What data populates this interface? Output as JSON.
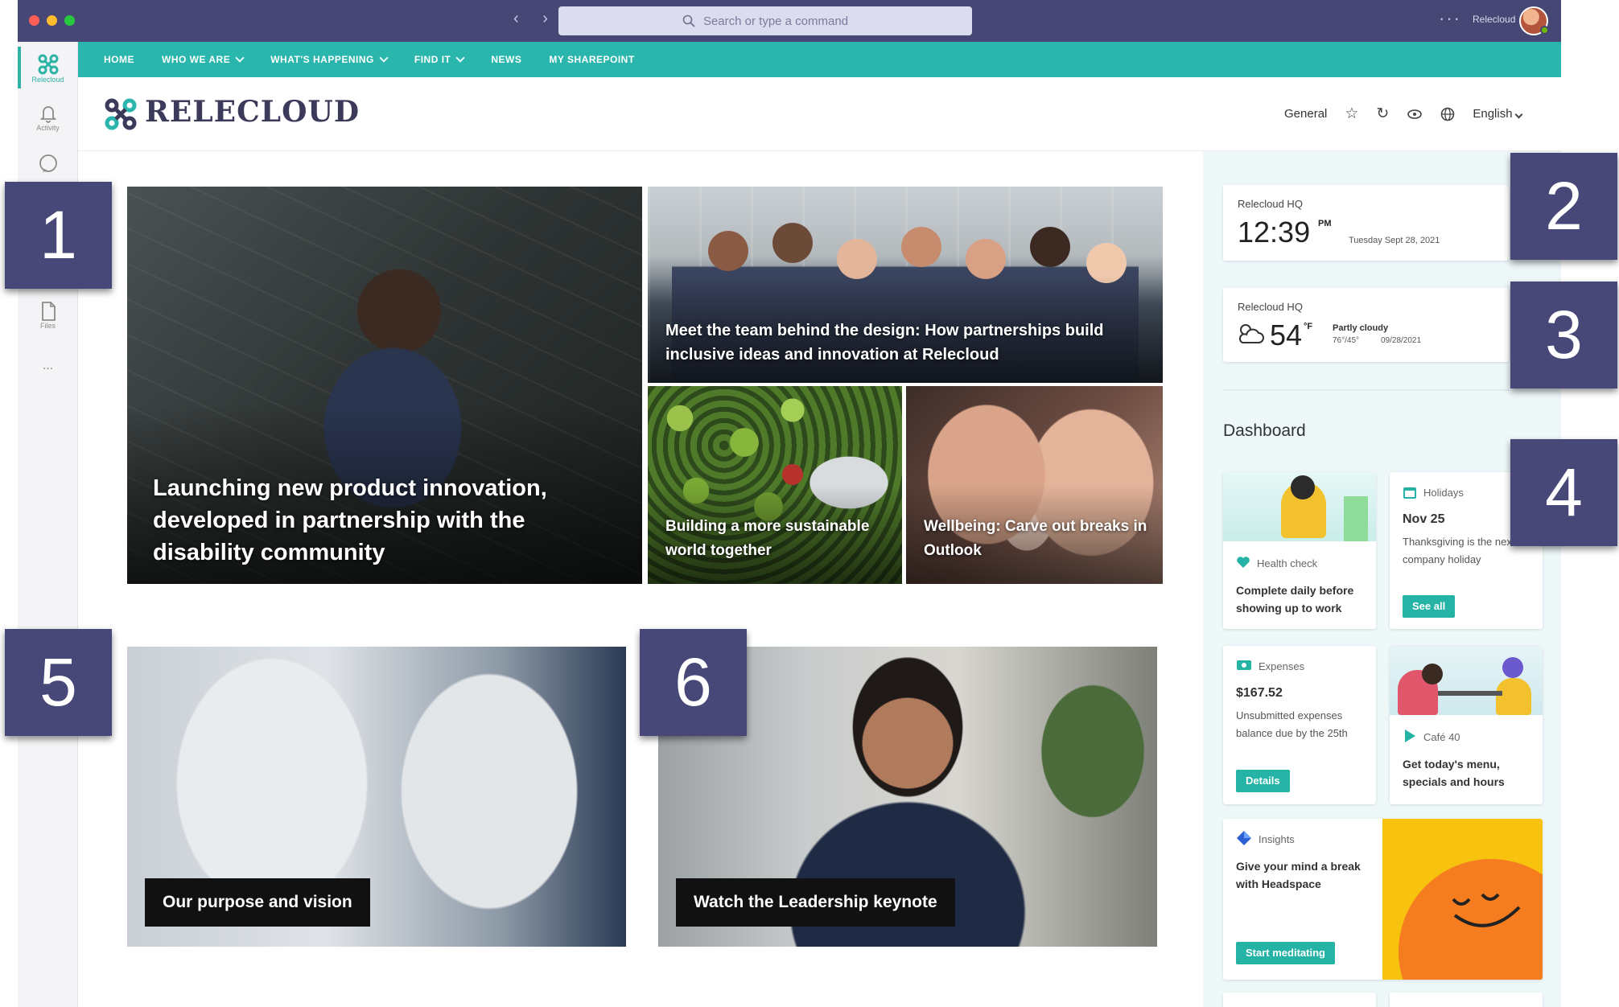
{
  "titlebar": {
    "search_placeholder": "Search or type a command",
    "nav_arrows": "‹ ›",
    "more": "···",
    "user_name": "Relecloud"
  },
  "rail": {
    "items": [
      {
        "label": "Relecloud",
        "icon": "relecloud-app-icon"
      },
      {
        "label": "Activity",
        "icon": "bell-icon"
      },
      {
        "label": "",
        "icon": "chat-icon"
      },
      {
        "label": "Files",
        "icon": "file-icon"
      }
    ],
    "more": "..."
  },
  "sitenav": {
    "items": [
      {
        "label": "HOME",
        "dropdown": false
      },
      {
        "label": "WHO WE ARE",
        "dropdown": true
      },
      {
        "label": "WHAT'S HAPPENING",
        "dropdown": true
      },
      {
        "label": "FIND IT",
        "dropdown": true
      },
      {
        "label": "NEWS",
        "dropdown": false
      },
      {
        "label": "MY SHAREPOINT",
        "dropdown": false
      }
    ]
  },
  "header": {
    "site_name": "RELECLOUD",
    "general_label": "General",
    "language": "English"
  },
  "news": {
    "hero": "Launching new product innovation, developed in partnership with the disability community",
    "top_right": "Meet the team behind the design: How partnerships build inclusive ideas and innovation at Relecloud",
    "bottom_mid": "Building a more sustainable world together",
    "bottom_right": "Wellbeing: Carve out breaks in Outlook"
  },
  "features": {
    "left": "Our purpose and vision",
    "right": "Watch the Leadership keynote"
  },
  "clock": {
    "location": "Relecloud HQ",
    "time": "12:39",
    "ampm": "PM",
    "date": "Tuesday Sept 28, 2021"
  },
  "weather": {
    "location": "Relecloud HQ",
    "temp": "54",
    "unit": "°F",
    "condition": "Partly cloudy",
    "range": "76°/45°",
    "date": "09/28/2021"
  },
  "dashboard": {
    "title": "Dashboard",
    "health": {
      "label": "Health check",
      "text": "Complete daily before showing up to work"
    },
    "holidays": {
      "label": "Holidays",
      "date": "Nov 25",
      "text": "Thanksgiving is the next company holiday",
      "button": "See all"
    },
    "expenses": {
      "label": "Expenses",
      "amount": "$167.52",
      "text": "Unsubmitted expenses balance due by the 25th",
      "button": "Details"
    },
    "cafe": {
      "label": "Café 40",
      "text": "Get today's menu, specials and hours"
    },
    "insights": {
      "label": "Insights",
      "text": "Give your mind a break with Headspace",
      "button": "Start meditating"
    }
  },
  "callouts": [
    "1",
    "2",
    "3",
    "4",
    "5",
    "6"
  ],
  "colors": {
    "titlebar": "#464775",
    "sitenav": "#2ab6ad",
    "accent": "#25b3a6",
    "callout": "#474877",
    "panel": "#eef8f9"
  }
}
